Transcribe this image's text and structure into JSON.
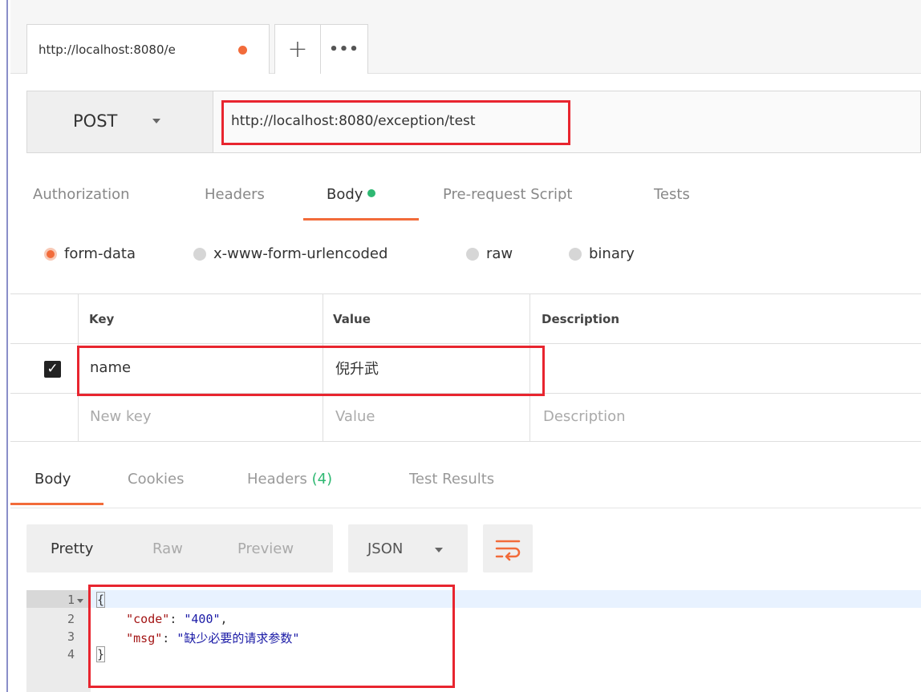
{
  "request_tab": {
    "label": "http://localhost:8080/e"
  },
  "tab_actions": {
    "new_tab": "+",
    "more": "•••"
  },
  "request": {
    "method": "POST",
    "url": "http://localhost:8080/exception/test"
  },
  "request_tabs": [
    "Authorization",
    "Headers",
    "Body",
    "Pre-request Script",
    "Tests"
  ],
  "body_types": [
    "form-data",
    "x-www-form-urlencoded",
    "raw",
    "binary"
  ],
  "params_table": {
    "headers": [
      "Key",
      "Value",
      "Description"
    ],
    "rows": [
      {
        "key": "name",
        "value": "倪升武",
        "description": ""
      }
    ],
    "placeholders": {
      "key": "New key",
      "value": "Value",
      "description": "Description"
    }
  },
  "response_tabs": {
    "body": "Body",
    "cookies": "Cookies",
    "headers": "Headers",
    "headers_count": "(4)",
    "test_results": "Test Results"
  },
  "view_modes": [
    "Pretty",
    "Raw",
    "Preview"
  ],
  "format": "JSON",
  "response_code": {
    "line_numbers": [
      "1",
      "2",
      "3",
      "4"
    ],
    "code_key": "\"code\"",
    "code_value": "\"400\"",
    "msg_key": "\"msg\"",
    "msg_value": "\"缺少必要的请求参数\""
  },
  "colors": {
    "accent": "#f26b3a",
    "success": "#2eb872",
    "highlight_box": "#e8252f"
  }
}
